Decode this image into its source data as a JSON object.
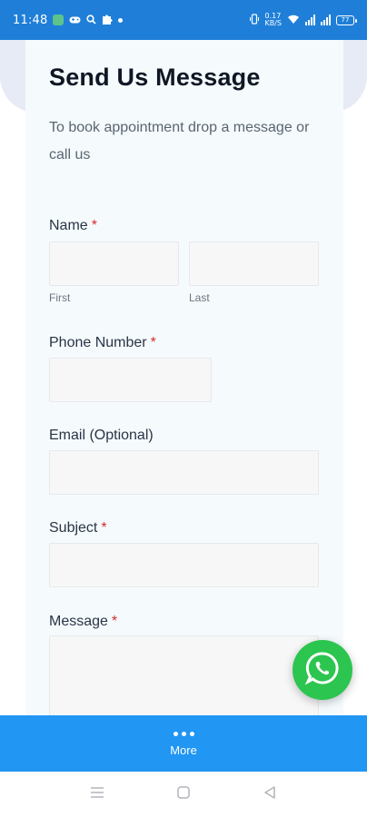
{
  "status_bar": {
    "time": "11:48",
    "battery": "77",
    "network_labels": [
      "0.17",
      "KB/S"
    ]
  },
  "form": {
    "title": "Send Us Message",
    "subtitle": "To book appointment drop a message or call us",
    "name": {
      "label": "Name",
      "required_mark": "*",
      "first_sublabel": "First",
      "last_sublabel": "Last",
      "first_value": "",
      "last_value": ""
    },
    "phone": {
      "label": "Phone Number",
      "required_mark": "*",
      "value": ""
    },
    "email": {
      "label": "Email (Optional)",
      "value": ""
    },
    "subject": {
      "label": "Subject",
      "required_mark": "*",
      "value": ""
    },
    "message": {
      "label": "Message",
      "required_mark": "*",
      "value": ""
    }
  },
  "bottom_bar": {
    "more_label": "More",
    "icon": "more-dots-icon"
  },
  "floating": {
    "icon": "whatsapp-icon",
    "color": "#2cc54f"
  },
  "colors": {
    "status_bar": "#1f7fd8",
    "bottom_bar": "#2196f3",
    "required": "#d62b2b"
  }
}
